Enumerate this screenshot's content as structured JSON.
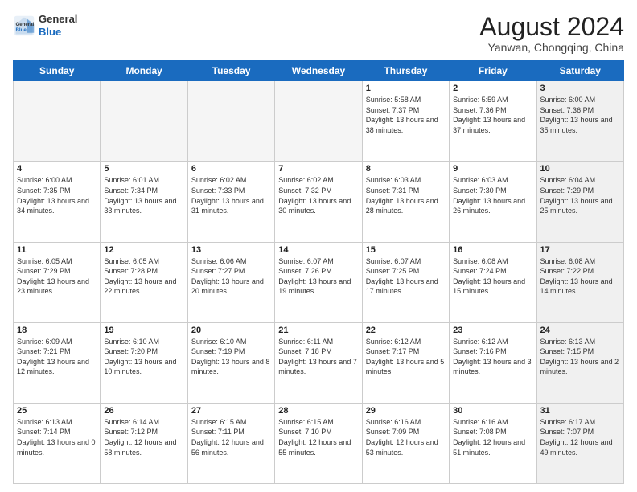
{
  "header": {
    "logo": {
      "general": "General",
      "blue": "Blue"
    },
    "title": "August 2024",
    "location": "Yanwan, Chongqing, China"
  },
  "weekdays": [
    "Sunday",
    "Monday",
    "Tuesday",
    "Wednesday",
    "Thursday",
    "Friday",
    "Saturday"
  ],
  "weeks": [
    [
      {
        "day": "",
        "empty": true
      },
      {
        "day": "",
        "empty": true
      },
      {
        "day": "",
        "empty": true
      },
      {
        "day": "",
        "empty": true
      },
      {
        "day": "1",
        "sunrise": "5:58 AM",
        "sunset": "7:37 PM",
        "daylight": "13 hours and 38 minutes."
      },
      {
        "day": "2",
        "sunrise": "5:59 AM",
        "sunset": "7:36 PM",
        "daylight": "13 hours and 37 minutes."
      },
      {
        "day": "3",
        "sunrise": "6:00 AM",
        "sunset": "7:36 PM",
        "daylight": "13 hours and 35 minutes.",
        "shaded": true
      }
    ],
    [
      {
        "day": "4",
        "sunrise": "6:00 AM",
        "sunset": "7:35 PM",
        "daylight": "13 hours and 34 minutes."
      },
      {
        "day": "5",
        "sunrise": "6:01 AM",
        "sunset": "7:34 PM",
        "daylight": "13 hours and 33 minutes."
      },
      {
        "day": "6",
        "sunrise": "6:02 AM",
        "sunset": "7:33 PM",
        "daylight": "13 hours and 31 minutes."
      },
      {
        "day": "7",
        "sunrise": "6:02 AM",
        "sunset": "7:32 PM",
        "daylight": "13 hours and 30 minutes."
      },
      {
        "day": "8",
        "sunrise": "6:03 AM",
        "sunset": "7:31 PM",
        "daylight": "13 hours and 28 minutes."
      },
      {
        "day": "9",
        "sunrise": "6:03 AM",
        "sunset": "7:30 PM",
        "daylight": "13 hours and 26 minutes."
      },
      {
        "day": "10",
        "sunrise": "6:04 AM",
        "sunset": "7:29 PM",
        "daylight": "13 hours and 25 minutes.",
        "shaded": true
      }
    ],
    [
      {
        "day": "11",
        "sunrise": "6:05 AM",
        "sunset": "7:29 PM",
        "daylight": "13 hours and 23 minutes."
      },
      {
        "day": "12",
        "sunrise": "6:05 AM",
        "sunset": "7:28 PM",
        "daylight": "13 hours and 22 minutes."
      },
      {
        "day": "13",
        "sunrise": "6:06 AM",
        "sunset": "7:27 PM",
        "daylight": "13 hours and 20 minutes."
      },
      {
        "day": "14",
        "sunrise": "6:07 AM",
        "sunset": "7:26 PM",
        "daylight": "13 hours and 19 minutes."
      },
      {
        "day": "15",
        "sunrise": "6:07 AM",
        "sunset": "7:25 PM",
        "daylight": "13 hours and 17 minutes."
      },
      {
        "day": "16",
        "sunrise": "6:08 AM",
        "sunset": "7:24 PM",
        "daylight": "13 hours and 15 minutes."
      },
      {
        "day": "17",
        "sunrise": "6:08 AM",
        "sunset": "7:22 PM",
        "daylight": "13 hours and 14 minutes.",
        "shaded": true
      }
    ],
    [
      {
        "day": "18",
        "sunrise": "6:09 AM",
        "sunset": "7:21 PM",
        "daylight": "13 hours and 12 minutes."
      },
      {
        "day": "19",
        "sunrise": "6:10 AM",
        "sunset": "7:20 PM",
        "daylight": "13 hours and 10 minutes."
      },
      {
        "day": "20",
        "sunrise": "6:10 AM",
        "sunset": "7:19 PM",
        "daylight": "13 hours and 8 minutes."
      },
      {
        "day": "21",
        "sunrise": "6:11 AM",
        "sunset": "7:18 PM",
        "daylight": "13 hours and 7 minutes."
      },
      {
        "day": "22",
        "sunrise": "6:12 AM",
        "sunset": "7:17 PM",
        "daylight": "13 hours and 5 minutes."
      },
      {
        "day": "23",
        "sunrise": "6:12 AM",
        "sunset": "7:16 PM",
        "daylight": "13 hours and 3 minutes."
      },
      {
        "day": "24",
        "sunrise": "6:13 AM",
        "sunset": "7:15 PM",
        "daylight": "13 hours and 2 minutes.",
        "shaded": true
      }
    ],
    [
      {
        "day": "25",
        "sunrise": "6:13 AM",
        "sunset": "7:14 PM",
        "daylight": "13 hours and 0 minutes."
      },
      {
        "day": "26",
        "sunrise": "6:14 AM",
        "sunset": "7:12 PM",
        "daylight": "12 hours and 58 minutes."
      },
      {
        "day": "27",
        "sunrise": "6:15 AM",
        "sunset": "7:11 PM",
        "daylight": "12 hours and 56 minutes."
      },
      {
        "day": "28",
        "sunrise": "6:15 AM",
        "sunset": "7:10 PM",
        "daylight": "12 hours and 55 minutes."
      },
      {
        "day": "29",
        "sunrise": "6:16 AM",
        "sunset": "7:09 PM",
        "daylight": "12 hours and 53 minutes."
      },
      {
        "day": "30",
        "sunrise": "6:16 AM",
        "sunset": "7:08 PM",
        "daylight": "12 hours and 51 minutes."
      },
      {
        "day": "31",
        "sunrise": "6:17 AM",
        "sunset": "7:07 PM",
        "daylight": "12 hours and 49 minutes.",
        "shaded": true
      }
    ]
  ],
  "labels": {
    "sunrise": "Sunrise:",
    "sunset": "Sunset:",
    "daylight": "Daylight:"
  }
}
